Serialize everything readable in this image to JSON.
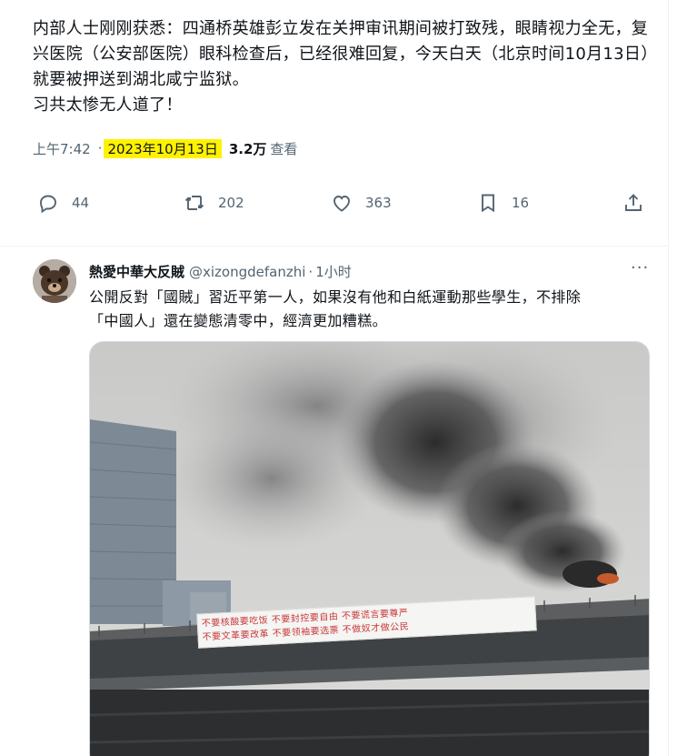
{
  "main_tweet": {
    "text_lines": [
      "内部人士刚刚获悉：四通桥英雄彭立发在关押审讯期间被打致残，眼睛视力全无，复兴医院（公安部医院）眼科检查后，已经很难回复，今天白天（北京时间10月13日）就要被押送到湖北咸宁监狱。",
      "习共太惨无人道了！"
    ],
    "time": "上午7:42",
    "separator": "·",
    "date": "2023年10月13日",
    "views_count": "3.2万",
    "views_label": "查看",
    "stats": {
      "replies": "44",
      "retweets": "202",
      "likes": "363",
      "bookmarks": "16"
    }
  },
  "reply_tweet": {
    "display_name": "熱愛中華大反賊",
    "handle": "@xizongdefanzhi",
    "separator": "·",
    "time_ago": "1小时",
    "more_label": "···",
    "text_lines": [
      "公開反對「國賊」習近平第一人，如果沒有他和白紙運動那些學生，不排除",
      "「中國人」還在變態清零中，經濟更加糟糕。"
    ],
    "banner_lines": [
      "不要核酸要吃饭  不要封控要自由  不要谎言要尊严",
      "不要文革要改革  不要领袖要选票  不做奴才做公民"
    ]
  },
  "icons": {
    "reply": "reply-icon",
    "retweet": "retweet-icon",
    "like": "heart-icon",
    "bookmark": "bookmark-icon",
    "share": "share-icon",
    "more": "more-icon",
    "avatar": "bear-avatar"
  },
  "colors": {
    "text": "#0f1419",
    "secondary": "#536471",
    "highlight": "#fff200",
    "border": "#eff3f4"
  }
}
